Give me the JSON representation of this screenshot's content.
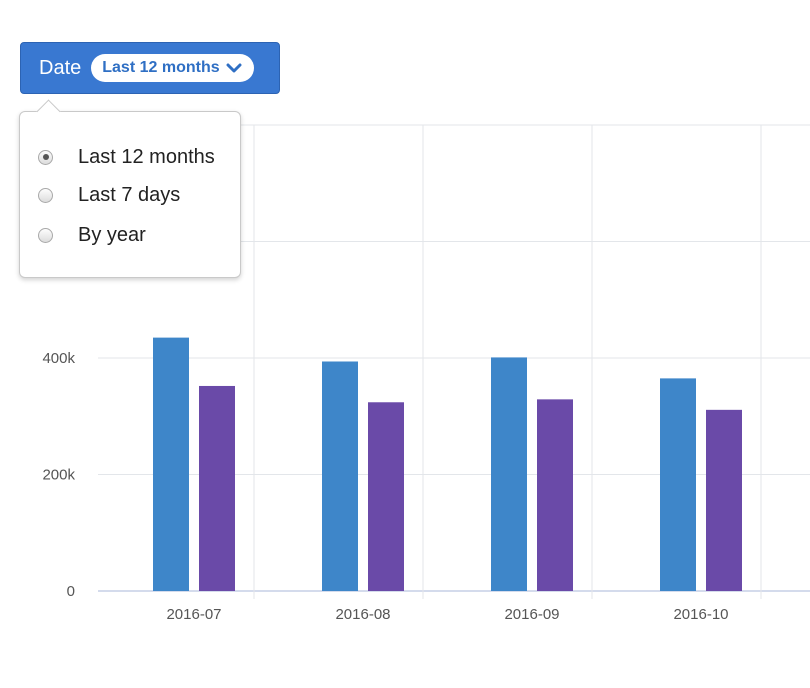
{
  "filter": {
    "label": "Date",
    "selected": "Last 12 months",
    "options": [
      {
        "label": "Last 12 months",
        "checked": true
      },
      {
        "label": "Last 7 days",
        "checked": false
      },
      {
        "label": "By year",
        "checked": false
      }
    ]
  },
  "colors": {
    "series1": "#3e86c9",
    "series2": "#6a4aa8",
    "accent": "#3978d1",
    "grid": "#e3e6ea",
    "axis": "#c6cfe6"
  },
  "chart_data": {
    "type": "bar",
    "categories": [
      "2016-07",
      "2016-08",
      "2016-09",
      "2016-10"
    ],
    "series": [
      {
        "values": [
          435000,
          394000,
          401000,
          365000
        ]
      },
      {
        "values": [
          352000,
          324000,
          329000,
          311000
        ]
      }
    ],
    "ylim": [
      0,
      800000
    ],
    "yticks": [
      0,
      200000,
      400000,
      600000,
      800000
    ],
    "ytick_labels": [
      "0",
      "200k",
      "400k",
      "",
      ""
    ],
    "grid": true,
    "legend": "none"
  }
}
